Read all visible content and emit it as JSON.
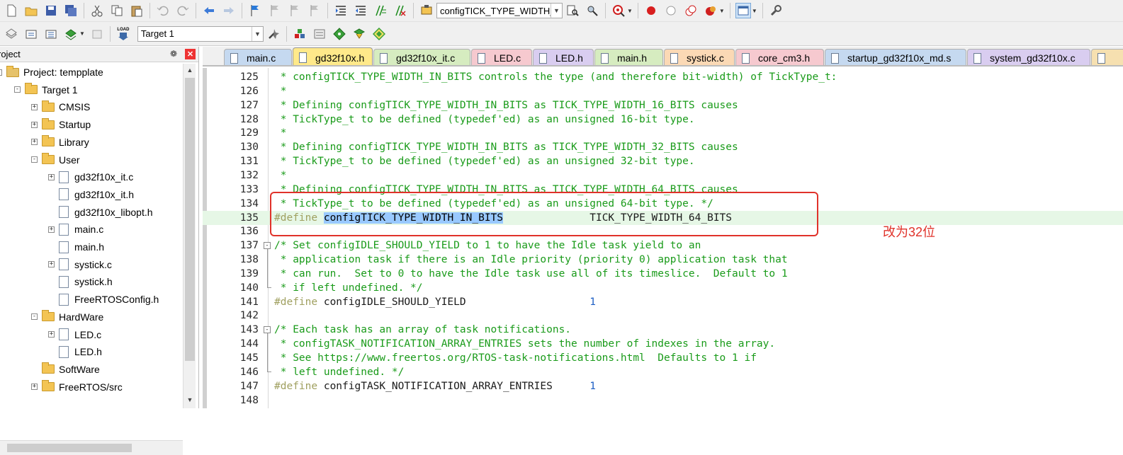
{
  "toolbar1": {
    "combo_value": "configTICK_TYPE_WIDTH_",
    "buttons": [
      "new-file",
      "open-file",
      "save",
      "save-all",
      "cut",
      "copy",
      "paste",
      "undo",
      "redo",
      "nav-back",
      "nav-forward",
      "bookmark",
      "prev-bookmark",
      "next-bookmark",
      "clear-bookmarks",
      "indent",
      "unindent",
      "comment",
      "uncomment",
      "find-in-files",
      "find",
      "incremental-find",
      "debug-session",
      "breakpoint",
      "disable-breakpoint",
      "kill-breakpoints",
      "clear-all",
      "window-layout",
      "configure"
    ]
  },
  "toolbar2": {
    "target_value": "Target 1",
    "load_label": "LOAD"
  },
  "panel": {
    "title": "roject",
    "pin": "❁",
    "close": "✕",
    "tree": [
      {
        "label": "Project: tempplate",
        "kind": "project",
        "level": 0,
        "expander": "-"
      },
      {
        "label": "Target 1",
        "kind": "target",
        "level": 1,
        "expander": "-"
      },
      {
        "label": "CMSIS",
        "kind": "folder",
        "level": 2,
        "expander": "+"
      },
      {
        "label": "Startup",
        "kind": "folder",
        "level": 2,
        "expander": "+"
      },
      {
        "label": "Library",
        "kind": "folder",
        "level": 2,
        "expander": "+"
      },
      {
        "label": "User",
        "kind": "folder-open",
        "level": 2,
        "expander": "-"
      },
      {
        "label": "gd32f10x_it.c",
        "kind": "file",
        "level": 3,
        "expander": "+"
      },
      {
        "label": "gd32f10x_it.h",
        "kind": "file",
        "level": 3,
        "expander": ""
      },
      {
        "label": "gd32f10x_libopt.h",
        "kind": "file",
        "level": 3,
        "expander": ""
      },
      {
        "label": "main.c",
        "kind": "file",
        "level": 3,
        "expander": "+"
      },
      {
        "label": "main.h",
        "kind": "file",
        "level": 3,
        "expander": ""
      },
      {
        "label": "systick.c",
        "kind": "file",
        "level": 3,
        "expander": "+"
      },
      {
        "label": "systick.h",
        "kind": "file",
        "level": 3,
        "expander": ""
      },
      {
        "label": "FreeRTOSConfig.h",
        "kind": "file",
        "level": 3,
        "expander": ""
      },
      {
        "label": "HardWare",
        "kind": "folder-open",
        "level": 2,
        "expander": "-"
      },
      {
        "label": "LED.c",
        "kind": "file",
        "level": 3,
        "expander": "+"
      },
      {
        "label": "LED.h",
        "kind": "file",
        "level": 3,
        "expander": ""
      },
      {
        "label": "SoftWare",
        "kind": "folder",
        "level": 2,
        "expander": ""
      },
      {
        "label": "FreeRTOS/src",
        "kind": "folder",
        "level": 2,
        "expander": "+"
      }
    ]
  },
  "tabs": [
    {
      "label": "main.c",
      "color": "#c5d9f0",
      "active": false
    },
    {
      "label": "gd32f10x.h",
      "color": "#ffe98a",
      "active": true
    },
    {
      "label": "gd32f10x_it.c",
      "color": "#d6ecc0",
      "active": false
    },
    {
      "label": "LED.c",
      "color": "#f6c9cf",
      "active": false
    },
    {
      "label": "LED.h",
      "color": "#d9cdf0",
      "active": false
    },
    {
      "label": "main.h",
      "color": "#d6ecc0",
      "active": false
    },
    {
      "label": "systick.c",
      "color": "#fbd9b5",
      "active": false
    },
    {
      "label": "core_cm3.h",
      "color": "#f6c9cf",
      "active": false
    },
    {
      "label": "startup_gd32f10x_md.s",
      "color": "#c5d9f0",
      "active": false
    },
    {
      "label": "system_gd32f10x.c",
      "color": "#d9cdf0",
      "active": false
    }
  ],
  "editor": {
    "lines": [
      {
        "n": "125",
        "segs": [
          {
            "t": " * configTICK_TYPE_WIDTH_IN_BITS controls the type (and therefore bit-width) of TickType_t:",
            "c": "cmt"
          }
        ]
      },
      {
        "n": "126",
        "segs": [
          {
            "t": " *",
            "c": "cmt"
          }
        ]
      },
      {
        "n": "127",
        "segs": [
          {
            "t": " * Defining configTICK_TYPE_WIDTH_IN_BITS as TICK_TYPE_WIDTH_16_BITS causes",
            "c": "cmt"
          }
        ]
      },
      {
        "n": "128",
        "segs": [
          {
            "t": " * TickType_t to be defined (typedef'ed) as an unsigned 16-bit type.",
            "c": "cmt"
          }
        ]
      },
      {
        "n": "129",
        "segs": [
          {
            "t": " *",
            "c": "cmt"
          }
        ]
      },
      {
        "n": "130",
        "segs": [
          {
            "t": " * Defining configTICK_TYPE_WIDTH_IN_BITS as TICK_TYPE_WIDTH_32_BITS causes",
            "c": "cmt"
          }
        ]
      },
      {
        "n": "131",
        "segs": [
          {
            "t": " * TickType_t to be defined (typedef'ed) as an unsigned 32-bit type.",
            "c": "cmt"
          }
        ]
      },
      {
        "n": "132",
        "segs": [
          {
            "t": " *",
            "c": "cmt"
          }
        ]
      },
      {
        "n": "133",
        "segs": [
          {
            "t": " * Defining configTICK_TYPE_WIDTH_IN_BITS as TICK_TYPE_WIDTH_64_BITS causes",
            "c": "cmt"
          }
        ]
      },
      {
        "n": "134",
        "segs": [
          {
            "t": " * TickType_t to be defined (typedef'ed) as an unsigned 64-bit type. */",
            "c": "cmt"
          }
        ]
      },
      {
        "n": "135",
        "hl": true,
        "segs": [
          {
            "t": "#define",
            "c": "pp"
          },
          {
            "t": " ",
            "c": "id"
          },
          {
            "t": "configTICK_TYPE_WIDTH_IN_BITS",
            "c": "sel"
          },
          {
            "t": "              TICK_TYPE_WIDTH_64_BITS",
            "c": "id"
          }
        ]
      },
      {
        "n": "136",
        "segs": []
      },
      {
        "n": "137",
        "fold": "-",
        "segs": [
          {
            "t": "/* Set configIDLE_SHOULD_YIELD to 1 to have the Idle task yield to an",
            "c": "cmt"
          }
        ]
      },
      {
        "n": "138",
        "segs": [
          {
            "t": " * application task if there is an Idle priority (priority 0) application task that",
            "c": "cmt"
          }
        ]
      },
      {
        "n": "139",
        "segs": [
          {
            "t": " * can run.  Set to 0 to have the Idle task use all of its timeslice.  Default to 1",
            "c": "cmt"
          }
        ]
      },
      {
        "n": "140",
        "foldend": true,
        "segs": [
          {
            "t": " * if left undefined. */",
            "c": "cmt"
          }
        ]
      },
      {
        "n": "141",
        "segs": [
          {
            "t": "#define",
            "c": "pp"
          },
          {
            "t": " configIDLE_SHOULD_YIELD                    ",
            "c": "id"
          },
          {
            "t": "1",
            "c": "num"
          }
        ]
      },
      {
        "n": "142",
        "segs": []
      },
      {
        "n": "143",
        "fold": "-",
        "segs": [
          {
            "t": "/* Each task has an array of task notifications.",
            "c": "cmt"
          }
        ]
      },
      {
        "n": "144",
        "segs": [
          {
            "t": " * configTASK_NOTIFICATION_ARRAY_ENTRIES sets the number of indexes in the array.",
            "c": "cmt"
          }
        ]
      },
      {
        "n": "145",
        "segs": [
          {
            "t": " * See https://www.freertos.org/RTOS-task-notifications.html  Defaults to 1 if",
            "c": "cmt"
          }
        ]
      },
      {
        "n": "146",
        "foldend": true,
        "segs": [
          {
            "t": " * left undefined. */",
            "c": "cmt"
          }
        ]
      },
      {
        "n": "147",
        "segs": [
          {
            "t": "#define",
            "c": "pp"
          },
          {
            "t": " configTASK_NOTIFICATION_ARRAY_ENTRIES      ",
            "c": "id"
          },
          {
            "t": "1",
            "c": "num"
          }
        ]
      },
      {
        "n": "148",
        "segs": []
      }
    ]
  },
  "annotation": {
    "text": "改为32位",
    "color": "#e0322a"
  }
}
